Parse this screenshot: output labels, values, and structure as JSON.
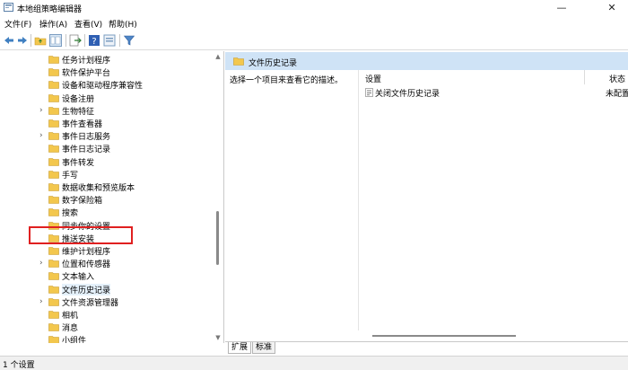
{
  "window": {
    "title": "本地组策略编辑器",
    "minimize_glyph": "—",
    "close_glyph": "✕"
  },
  "menubar": {
    "items": [
      "文件(F)",
      "操作(A)",
      "查看(V)",
      "帮助(H)"
    ]
  },
  "toolbar": {
    "icons": [
      "back-arrow-icon",
      "forward-arrow-icon",
      "folder-up-icon",
      "show-hide-tree-icon",
      "export-list-icon",
      "help-icon",
      "properties-icon",
      "filter-icon"
    ]
  },
  "tree": {
    "items": [
      {
        "label": "任务计划程序",
        "expandable": false,
        "selected": false
      },
      {
        "label": "软件保护平台",
        "expandable": false,
        "selected": false
      },
      {
        "label": "设备和驱动程序兼容性",
        "expandable": false,
        "selected": false
      },
      {
        "label": "设备注册",
        "expandable": false,
        "selected": false
      },
      {
        "label": "生物特征",
        "expandable": true,
        "selected": false
      },
      {
        "label": "事件查看器",
        "expandable": false,
        "selected": false
      },
      {
        "label": "事件日志服务",
        "expandable": true,
        "selected": false
      },
      {
        "label": "事件日志记录",
        "expandable": false,
        "selected": false
      },
      {
        "label": "事件转发",
        "expandable": false,
        "selected": false
      },
      {
        "label": "手写",
        "expandable": false,
        "selected": false
      },
      {
        "label": "数据收集和预览版本",
        "expandable": false,
        "selected": false
      },
      {
        "label": "数字保险箱",
        "expandable": false,
        "selected": false
      },
      {
        "label": "搜索",
        "expandable": false,
        "selected": false
      },
      {
        "label": "同步你的设置",
        "expandable": false,
        "selected": false
      },
      {
        "label": "推送安装",
        "expandable": false,
        "selected": false
      },
      {
        "label": "维护计划程序",
        "expandable": false,
        "selected": false
      },
      {
        "label": "位置和传感器",
        "expandable": true,
        "selected": false
      },
      {
        "label": "文本输入",
        "expandable": false,
        "selected": false
      },
      {
        "label": "文件历史记录",
        "expandable": false,
        "selected": true
      },
      {
        "label": "文件资源管理器",
        "expandable": true,
        "selected": false
      },
      {
        "label": "相机",
        "expandable": false,
        "selected": false
      },
      {
        "label": "消息",
        "expandable": false,
        "selected": false
      },
      {
        "label": "小组件",
        "expandable": false,
        "selected": false
      }
    ],
    "expand_glyph": "›",
    "scroll_up_glyph": "▲",
    "scroll_down_glyph": "▼"
  },
  "right_pane": {
    "header_title": "文件历史记录",
    "description": "选择一个项目来查看它的描述。",
    "columns": {
      "setting": "设置",
      "status": "状态"
    },
    "rows": [
      {
        "name": "关闭文件历史记录",
        "status": "未配置"
      }
    ]
  },
  "tabs": [
    {
      "label": "扩展",
      "active": true
    },
    {
      "label": "标准",
      "active": false
    }
  ],
  "statusbar": {
    "text": "1 个设置"
  },
  "colors": {
    "header_bg": "#cfe3f6",
    "highlight_border": "#e02020",
    "folder_yellow": "#f3c74d"
  }
}
